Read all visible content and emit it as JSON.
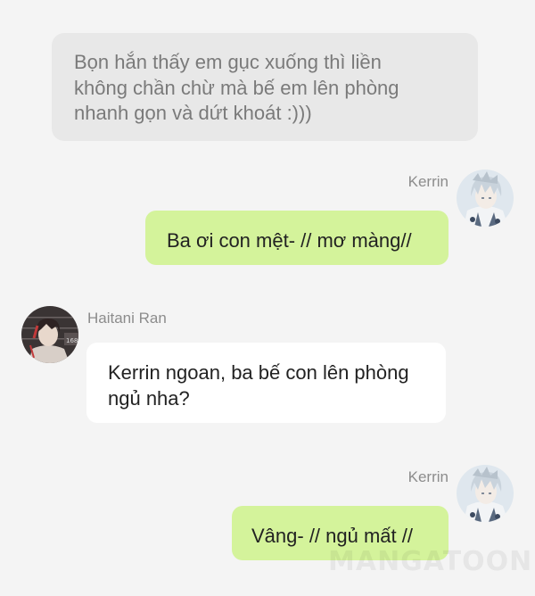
{
  "narration": {
    "line1": "Bọn hắn thấy em gục xuống thì liền",
    "line2": "không chần chừ mà bế em lên phòng",
    "line3": "nhanh gọn và dứt khoát :)))"
  },
  "messages": [
    {
      "sender": "Kerrin",
      "side": "right",
      "text": "Ba ơi con mệt- // mơ màng//",
      "avatar_icon": "anime-avatar-silver-hair"
    },
    {
      "sender": "Haitani Ran",
      "side": "left",
      "line1": "Kerrin ngoan, ba bế con lên phòng",
      "line2": "ngủ nha?",
      "avatar_icon": "anime-avatar-mugshot"
    },
    {
      "sender": "Kerrin",
      "side": "right",
      "text": "Vâng- // ngủ mất //",
      "avatar_icon": "anime-avatar-silver-hair"
    }
  ],
  "colors": {
    "background": "#f4f4f4",
    "narration_bg": "#e8e8e8",
    "right_bubble": "#d4f39b",
    "left_bubble": "#ffffff"
  },
  "watermark": "MANGATOON"
}
